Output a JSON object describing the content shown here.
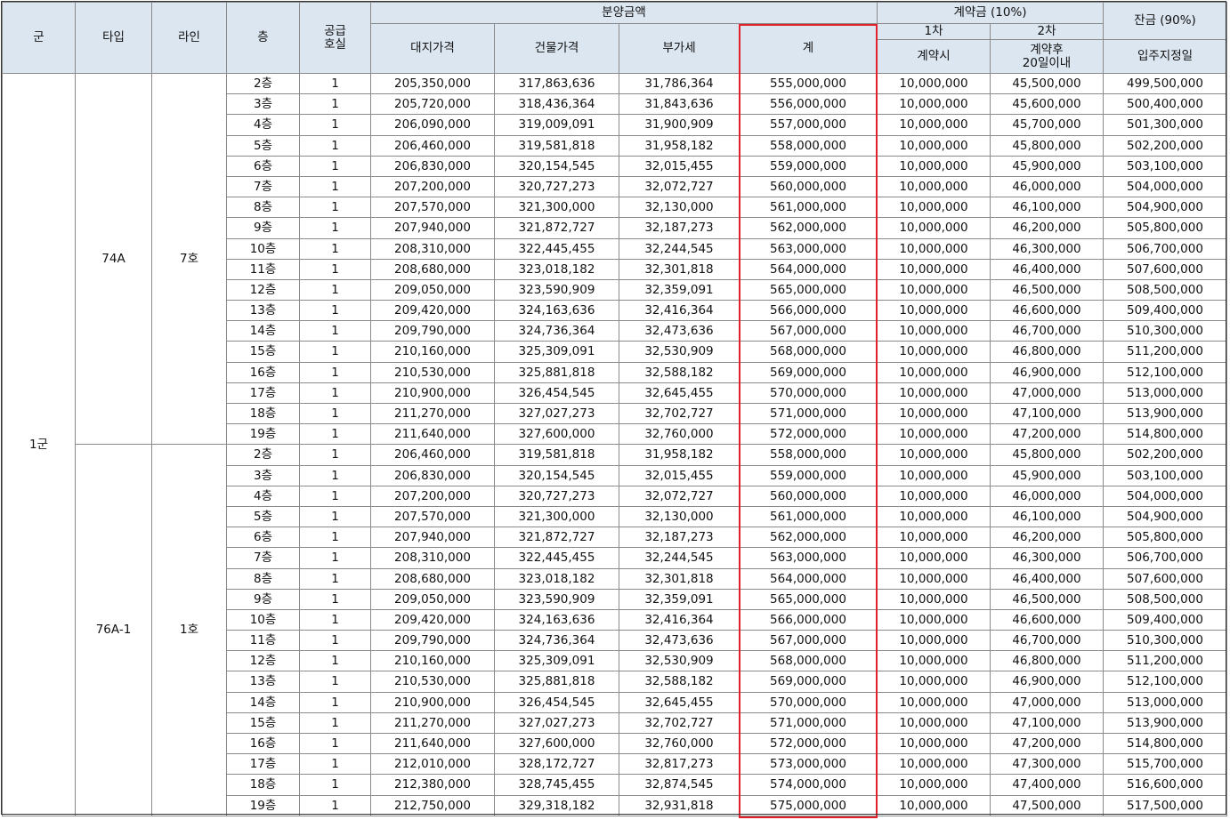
{
  "header": {
    "gun": "군",
    "type": "타입",
    "line": "라인",
    "floor": "층",
    "supply_units": "공급\n호실",
    "sale_price": "분양금액",
    "land_price": "대지가격",
    "building_price": "건물가격",
    "vat": "부가세",
    "total": "계",
    "deposit": "계약금 (10%)",
    "deposit_1": "1차",
    "deposit_2": "2차",
    "deposit_1_when": "계약시",
    "deposit_2_when": "계약후\n20일이내",
    "balance": "잔금 (90%)",
    "balance_when": "입주지정일"
  },
  "group_label": "1군",
  "units": [
    {
      "type": "74A",
      "line": "7호",
      "rows": [
        [
          "2층",
          "1",
          "205,350,000",
          "317,863,636",
          "31,786,364",
          "555,000,000",
          "10,000,000",
          "45,500,000",
          "499,500,000"
        ],
        [
          "3층",
          "1",
          "205,720,000",
          "318,436,364",
          "31,843,636",
          "556,000,000",
          "10,000,000",
          "45,600,000",
          "500,400,000"
        ],
        [
          "4층",
          "1",
          "206,090,000",
          "319,009,091",
          "31,900,909",
          "557,000,000",
          "10,000,000",
          "45,700,000",
          "501,300,000"
        ],
        [
          "5층",
          "1",
          "206,460,000",
          "319,581,818",
          "31,958,182",
          "558,000,000",
          "10,000,000",
          "45,800,000",
          "502,200,000"
        ],
        [
          "6층",
          "1",
          "206,830,000",
          "320,154,545",
          "32,015,455",
          "559,000,000",
          "10,000,000",
          "45,900,000",
          "503,100,000"
        ],
        [
          "7층",
          "1",
          "207,200,000",
          "320,727,273",
          "32,072,727",
          "560,000,000",
          "10,000,000",
          "46,000,000",
          "504,000,000"
        ],
        [
          "8층",
          "1",
          "207,570,000",
          "321,300,000",
          "32,130,000",
          "561,000,000",
          "10,000,000",
          "46,100,000",
          "504,900,000"
        ],
        [
          "9층",
          "1",
          "207,940,000",
          "321,872,727",
          "32,187,273",
          "562,000,000",
          "10,000,000",
          "46,200,000",
          "505,800,000"
        ],
        [
          "10층",
          "1",
          "208,310,000",
          "322,445,455",
          "32,244,545",
          "563,000,000",
          "10,000,000",
          "46,300,000",
          "506,700,000"
        ],
        [
          "11층",
          "1",
          "208,680,000",
          "323,018,182",
          "32,301,818",
          "564,000,000",
          "10,000,000",
          "46,400,000",
          "507,600,000"
        ],
        [
          "12층",
          "1",
          "209,050,000",
          "323,590,909",
          "32,359,091",
          "565,000,000",
          "10,000,000",
          "46,500,000",
          "508,500,000"
        ],
        [
          "13층",
          "1",
          "209,420,000",
          "324,163,636",
          "32,416,364",
          "566,000,000",
          "10,000,000",
          "46,600,000",
          "509,400,000"
        ],
        [
          "14층",
          "1",
          "209,790,000",
          "324,736,364",
          "32,473,636",
          "567,000,000",
          "10,000,000",
          "46,700,000",
          "510,300,000"
        ],
        [
          "15층",
          "1",
          "210,160,000",
          "325,309,091",
          "32,530,909",
          "568,000,000",
          "10,000,000",
          "46,800,000",
          "511,200,000"
        ],
        [
          "16층",
          "1",
          "210,530,000",
          "325,881,818",
          "32,588,182",
          "569,000,000",
          "10,000,000",
          "46,900,000",
          "512,100,000"
        ],
        [
          "17층",
          "1",
          "210,900,000",
          "326,454,545",
          "32,645,455",
          "570,000,000",
          "10,000,000",
          "47,000,000",
          "513,000,000"
        ],
        [
          "18층",
          "1",
          "211,270,000",
          "327,027,273",
          "32,702,727",
          "571,000,000",
          "10,000,000",
          "47,100,000",
          "513,900,000"
        ],
        [
          "19층",
          "1",
          "211,640,000",
          "327,600,000",
          "32,760,000",
          "572,000,000",
          "10,000,000",
          "47,200,000",
          "514,800,000"
        ]
      ]
    },
    {
      "type": "76A-1",
      "line": "1호",
      "rows": [
        [
          "2층",
          "1",
          "206,460,000",
          "319,581,818",
          "31,958,182",
          "558,000,000",
          "10,000,000",
          "45,800,000",
          "502,200,000"
        ],
        [
          "3층",
          "1",
          "206,830,000",
          "320,154,545",
          "32,015,455",
          "559,000,000",
          "10,000,000",
          "45,900,000",
          "503,100,000"
        ],
        [
          "4층",
          "1",
          "207,200,000",
          "320,727,273",
          "32,072,727",
          "560,000,000",
          "10,000,000",
          "46,000,000",
          "504,000,000"
        ],
        [
          "5층",
          "1",
          "207,570,000",
          "321,300,000",
          "32,130,000",
          "561,000,000",
          "10,000,000",
          "46,100,000",
          "504,900,000"
        ],
        [
          "6층",
          "1",
          "207,940,000",
          "321,872,727",
          "32,187,273",
          "562,000,000",
          "10,000,000",
          "46,200,000",
          "505,800,000"
        ],
        [
          "7층",
          "1",
          "208,310,000",
          "322,445,455",
          "32,244,545",
          "563,000,000",
          "10,000,000",
          "46,300,000",
          "506,700,000"
        ],
        [
          "8층",
          "1",
          "208,680,000",
          "323,018,182",
          "32,301,818",
          "564,000,000",
          "10,000,000",
          "46,400,000",
          "507,600,000"
        ],
        [
          "9층",
          "1",
          "209,050,000",
          "323,590,909",
          "32,359,091",
          "565,000,000",
          "10,000,000",
          "46,500,000",
          "508,500,000"
        ],
        [
          "10층",
          "1",
          "209,420,000",
          "324,163,636",
          "32,416,364",
          "566,000,000",
          "10,000,000",
          "46,600,000",
          "509,400,000"
        ],
        [
          "11층",
          "1",
          "209,790,000",
          "324,736,364",
          "32,473,636",
          "567,000,000",
          "10,000,000",
          "46,700,000",
          "510,300,000"
        ],
        [
          "12층",
          "1",
          "210,160,000",
          "325,309,091",
          "32,530,909",
          "568,000,000",
          "10,000,000",
          "46,800,000",
          "511,200,000"
        ],
        [
          "13층",
          "1",
          "210,530,000",
          "325,881,818",
          "32,588,182",
          "569,000,000",
          "10,000,000",
          "46,900,000",
          "512,100,000"
        ],
        [
          "14층",
          "1",
          "210,900,000",
          "326,454,545",
          "32,645,455",
          "570,000,000",
          "10,000,000",
          "47,000,000",
          "513,000,000"
        ],
        [
          "15층",
          "1",
          "211,270,000",
          "327,027,273",
          "32,702,727",
          "571,000,000",
          "10,000,000",
          "47,100,000",
          "513,900,000"
        ],
        [
          "16층",
          "1",
          "211,640,000",
          "327,600,000",
          "32,760,000",
          "572,000,000",
          "10,000,000",
          "47,200,000",
          "514,800,000"
        ],
        [
          "17층",
          "1",
          "212,010,000",
          "328,172,727",
          "32,817,273",
          "573,000,000",
          "10,000,000",
          "47,300,000",
          "515,700,000"
        ],
        [
          "18층",
          "1",
          "212,380,000",
          "328,745,455",
          "32,874,545",
          "574,000,000",
          "10,000,000",
          "47,400,000",
          "516,600,000"
        ],
        [
          "19층",
          "1",
          "212,750,000",
          "329,318,182",
          "32,931,818",
          "575,000,000",
          "10,000,000",
          "47,500,000",
          "517,500,000"
        ]
      ]
    }
  ],
  "colors": {
    "header_bg": "#dce6f1",
    "highlight_border": "#e2212b",
    "grid": "#8a8a8a"
  }
}
